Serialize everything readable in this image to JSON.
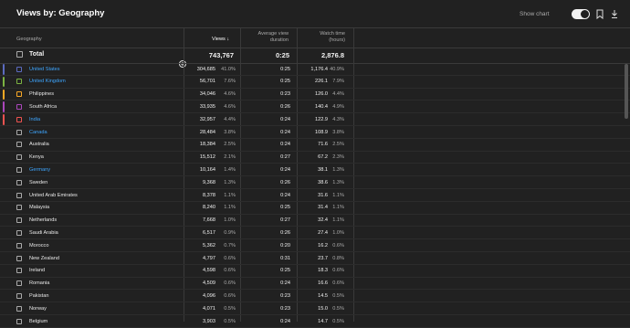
{
  "header": {
    "title": "Views by: Geography",
    "show_chart_label": "Show chart",
    "show_chart_on": true
  },
  "columns": {
    "geography": "Geography",
    "views": "Views",
    "avd_line1": "Average view",
    "avd_line2": "duration",
    "wt_line1": "Watch time",
    "wt_line2": "(hours)"
  },
  "total": {
    "label": "Total",
    "views": "743,767",
    "avd": "0:25",
    "watch_time": "2,876.8"
  },
  "rows": [
    {
      "name": "United States",
      "views": "304,685",
      "vpct": "41.0%",
      "avd": "0:25",
      "wt": "1,176.4",
      "wtpct": "40.9%",
      "link": true,
      "color": "#5c6bc0"
    },
    {
      "name": "United Kingdom",
      "views": "56,701",
      "vpct": "7.6%",
      "avd": "0:25",
      "wt": "226.1",
      "wtpct": "7.9%",
      "link": true,
      "color": "#7cb342"
    },
    {
      "name": "Philippines",
      "views": "34,046",
      "vpct": "4.6%",
      "avd": "0:23",
      "wt": "126.0",
      "wtpct": "4.4%",
      "link": false,
      "color": "#f9a825"
    },
    {
      "name": "South Africa",
      "views": "33,935",
      "vpct": "4.6%",
      "avd": "0:26",
      "wt": "140.4",
      "wtpct": "4.9%",
      "link": false,
      "color": "#ab47bc"
    },
    {
      "name": "India",
      "views": "32,957",
      "vpct": "4.4%",
      "avd": "0:24",
      "wt": "122.9",
      "wtpct": "4.3%",
      "link": true,
      "color": "#ef5350"
    },
    {
      "name": "Canada",
      "views": "28,484",
      "vpct": "3.8%",
      "avd": "0:24",
      "wt": "108.9",
      "wtpct": "3.8%",
      "link": true,
      "color": ""
    },
    {
      "name": "Australia",
      "views": "18,384",
      "vpct": "2.5%",
      "avd": "0:24",
      "wt": "71.6",
      "wtpct": "2.5%",
      "link": false,
      "color": ""
    },
    {
      "name": "Kenya",
      "views": "15,512",
      "vpct": "2.1%",
      "avd": "0:27",
      "wt": "67.2",
      "wtpct": "2.3%",
      "link": false,
      "color": ""
    },
    {
      "name": "Germany",
      "views": "10,164",
      "vpct": "1.4%",
      "avd": "0:24",
      "wt": "38.1",
      "wtpct": "1.3%",
      "link": true,
      "color": ""
    },
    {
      "name": "Sweden",
      "views": "9,368",
      "vpct": "1.3%",
      "avd": "0:26",
      "wt": "38.6",
      "wtpct": "1.3%",
      "link": false,
      "color": ""
    },
    {
      "name": "United Arab Emirates",
      "views": "8,378",
      "vpct": "1.1%",
      "avd": "0:24",
      "wt": "31.6",
      "wtpct": "1.1%",
      "link": false,
      "color": ""
    },
    {
      "name": "Malaysia",
      "views": "8,240",
      "vpct": "1.1%",
      "avd": "0:25",
      "wt": "31.4",
      "wtpct": "1.1%",
      "link": false,
      "color": ""
    },
    {
      "name": "Netherlands",
      "views": "7,668",
      "vpct": "1.0%",
      "avd": "0:27",
      "wt": "32.4",
      "wtpct": "1.1%",
      "link": false,
      "color": ""
    },
    {
      "name": "Saudi Arabia",
      "views": "6,517",
      "vpct": "0.9%",
      "avd": "0:26",
      "wt": "27.4",
      "wtpct": "1.0%",
      "link": false,
      "color": ""
    },
    {
      "name": "Morocco",
      "views": "5,362",
      "vpct": "0.7%",
      "avd": "0:20",
      "wt": "16.2",
      "wtpct": "0.6%",
      "link": false,
      "color": ""
    },
    {
      "name": "New Zealand",
      "views": "4,797",
      "vpct": "0.6%",
      "avd": "0:31",
      "wt": "23.7",
      "wtpct": "0.8%",
      "link": false,
      "color": ""
    },
    {
      "name": "Ireland",
      "views": "4,598",
      "vpct": "0.6%",
      "avd": "0:25",
      "wt": "18.3",
      "wtpct": "0.6%",
      "link": false,
      "color": ""
    },
    {
      "name": "Romania",
      "views": "4,509",
      "vpct": "0.6%",
      "avd": "0:24",
      "wt": "16.6",
      "wtpct": "0.6%",
      "link": false,
      "color": ""
    },
    {
      "name": "Pakistan",
      "views": "4,096",
      "vpct": "0.6%",
      "avd": "0:23",
      "wt": "14.5",
      "wtpct": "0.5%",
      "link": false,
      "color": ""
    },
    {
      "name": "Norway",
      "views": "4,071",
      "vpct": "0.5%",
      "avd": "0:23",
      "wt": "15.0",
      "wtpct": "0.5%",
      "link": false,
      "color": ""
    },
    {
      "name": "Belgium",
      "views": "3,903",
      "vpct": "0.5%",
      "avd": "0:24",
      "wt": "14.7",
      "wtpct": "0.5%",
      "link": false,
      "color": ""
    }
  ]
}
